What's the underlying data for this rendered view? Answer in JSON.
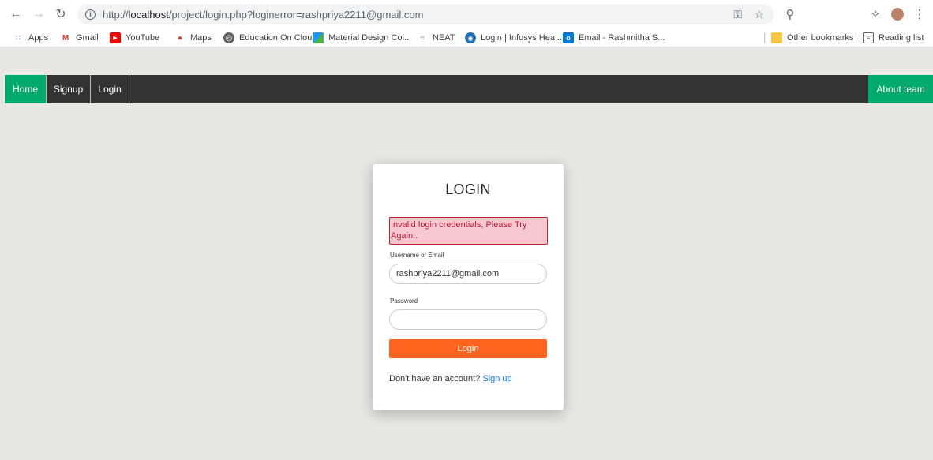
{
  "browser": {
    "url_prefix": "http://",
    "url_host": "localhost",
    "url_rest": "/project/login.php?loginerror=rashpriya2211@gmail.com",
    "bookmarks": [
      {
        "label": "Apps",
        "icon": "apps-grid-icon",
        "color": "#1a73e8"
      },
      {
        "label": "Gmail",
        "icon": "gmail-icon",
        "color": "#d93025"
      },
      {
        "label": "YouTube",
        "icon": "youtube-icon",
        "color": "#ff0000"
      },
      {
        "label": "Maps",
        "icon": "maps-pin-icon",
        "color": "#1e8e3e"
      },
      {
        "label": "Education On Clou...",
        "icon": "globe-icon",
        "color": "#5f6368"
      },
      {
        "label": "Material Design Col...",
        "icon": "material-icon",
        "color": "#2196f3"
      },
      {
        "label": "NEAT",
        "icon": "neat-icon",
        "color": "#9aa0a6"
      },
      {
        "label": "Login | Infosys Hea...",
        "icon": "infosys-icon",
        "color": "#1f6fb2"
      },
      {
        "label": "Email - Rashmitha S...",
        "icon": "outlook-icon",
        "color": "#0078d4"
      }
    ],
    "other_bookmarks": "Other bookmarks",
    "reading_list": "Reading list"
  },
  "navbar": {
    "home": "Home",
    "signup": "Signup",
    "login": "Login",
    "about": "About team",
    "accent_color": "#04aa6d"
  },
  "login_card": {
    "title": "LOGIN",
    "error": "Invalid login credentials, Please Try Again..",
    "username_label": "Username or Email",
    "username_value": "rashpriya2211@gmail.com",
    "password_label": "Password",
    "password_value": "",
    "button": "Login",
    "button_color": "#fd6420",
    "account_prompt": "Don't have an account?",
    "signup_link": "Sign up"
  }
}
